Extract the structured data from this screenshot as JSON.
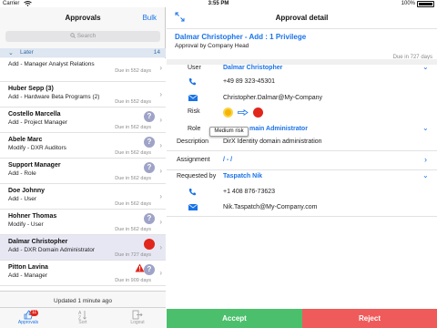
{
  "status": {
    "carrier": "Carrier",
    "time": "3:55 PM",
    "battery": "100%"
  },
  "left": {
    "title": "Approvals",
    "bulk": "Bulk",
    "search_placeholder": "Search",
    "group": {
      "label": "Later",
      "count": "14"
    },
    "items": [
      {
        "title": "",
        "subtitle": "Add - Manager Analyst Relations",
        "due": "Due in 552 days",
        "badge": "none"
      },
      {
        "title": "Huber Sepp (3)",
        "subtitle": "Add - Hardware Beta Programs (2)",
        "due": "Due in 552 days",
        "badge": "none"
      },
      {
        "title": "Costello Marcella",
        "subtitle": "Add - Project Manager",
        "due": "Due in 562 days",
        "badge": "question"
      },
      {
        "title": "Abele Marc",
        "subtitle": "Modify - DXR Auditors",
        "due": "Due in 562 days",
        "badge": "question"
      },
      {
        "title": "Support Manager",
        "subtitle": "Add - Role",
        "due": "Due in 562 days",
        "badge": "question"
      },
      {
        "title": "Doe Johnny",
        "subtitle": "Add - User",
        "due": "Due in 562 days",
        "badge": "none"
      },
      {
        "title": "Hohner Thomas",
        "subtitle": "Modify - User",
        "due": "Due in 562 days",
        "badge": "question"
      },
      {
        "title": "Dalmar Christopher",
        "subtitle": "Add - DXR Domain Administrator",
        "due": "Due in 727 days",
        "badge": "red"
      },
      {
        "title": "Pitton Lavina",
        "subtitle": "Add - Manager",
        "due": "Due in 909 days",
        "badge": "warn-question"
      }
    ],
    "updated": "Updated 1 minute ago",
    "tabs": {
      "approvals": "Approvals",
      "approvals_badge": "11",
      "sort": "Sort",
      "logout": "Logout"
    }
  },
  "right": {
    "title": "Approval detail",
    "header_title": "Dalmar Christopher - Add : 1 Privilege",
    "header_sub": "Approval by Company Head",
    "header_due": "Due in 727 days",
    "user_label": "User",
    "user_name": "Dalmar Christopher",
    "user_phone": "+49 89 323-45301",
    "user_email": "Christopher.Dalmar@My-Company",
    "risk_label": "Risk",
    "risk_tooltip": "Medium risk",
    "role_label": "Role",
    "role_value": "main Administrator",
    "description_label": "Description",
    "description_value": "DirX Identity domain administration",
    "assignment_label": "Assignment",
    "assignment_value": "/ - /",
    "requested_label": "Requested by",
    "requested_name": "Taspatch Nik",
    "requested_phone": "+1 408 876-73623",
    "requested_email": "Nik.Taspatch@My-Company.com",
    "accept": "Accept",
    "reject": "Reject"
  },
  "colors": {
    "accent": "#1a73e8",
    "accept": "#4cbf6c",
    "reject": "#ef5b5b",
    "risk_red": "#e1261c",
    "risk_yellow": "#f4b400"
  }
}
